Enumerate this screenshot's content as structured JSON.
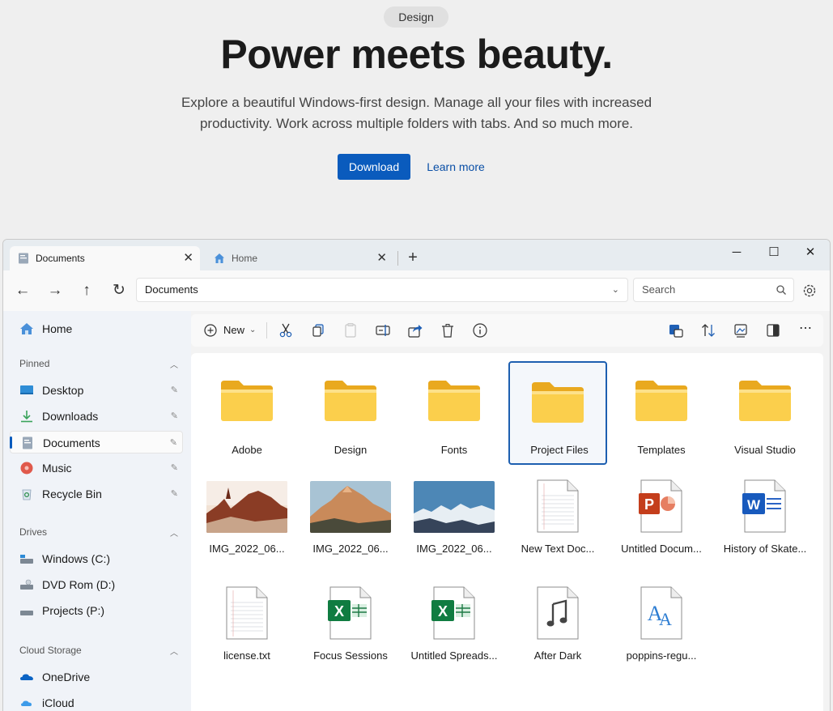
{
  "hero": {
    "pill": "Design",
    "title": "Power meets beauty.",
    "description": "Explore a beautiful Windows-first design. Manage all your files with increased productivity. Work across multiple folders with tabs. And so much more.",
    "download_label": "Download",
    "learn_more_label": "Learn more",
    "accent_color": "#0a5bbd"
  },
  "window": {
    "tabs": [
      {
        "label": "Documents",
        "icon": "documents-icon",
        "active": true
      },
      {
        "label": "Home",
        "icon": "home-icon",
        "active": false
      }
    ],
    "new_tab_icon": "plus-icon",
    "controls": [
      "minimize-icon",
      "maximize-icon",
      "close-icon"
    ]
  },
  "navbar": {
    "address": "Documents",
    "search_placeholder": "Search"
  },
  "toolbar": {
    "new_label": "New",
    "icons": [
      "cut-icon",
      "copy-icon",
      "paste-icon",
      "rename-icon",
      "share-icon",
      "delete-icon",
      "info-icon",
      "preview-icon",
      "sort-icon",
      "image-icon",
      "pane-icon",
      "more-icon"
    ]
  },
  "sidebar": {
    "home": "Home",
    "pinned_header": "Pinned",
    "pinned": [
      {
        "label": "Desktop",
        "icon": "desktop-icon"
      },
      {
        "label": "Downloads",
        "icon": "downloads-icon"
      },
      {
        "label": "Documents",
        "icon": "documents-icon",
        "selected": true
      },
      {
        "label": "Music",
        "icon": "music-icon"
      },
      {
        "label": "Recycle Bin",
        "icon": "recycle-bin-icon"
      }
    ],
    "drives_header": "Drives",
    "drives": [
      {
        "label": "Windows (C:)",
        "icon": "drive-icon"
      },
      {
        "label": "DVD Rom (D:)",
        "icon": "dvd-icon"
      },
      {
        "label": "Projects (P:)",
        "icon": "drive-icon"
      }
    ],
    "cloud_header": "Cloud Storage",
    "cloud": [
      {
        "label": "OneDrive",
        "icon": "onedrive-icon"
      },
      {
        "label": "iCloud",
        "icon": "icloud-icon"
      }
    ]
  },
  "files": [
    {
      "name": "Adobe",
      "type": "folder"
    },
    {
      "name": "Design",
      "type": "folder"
    },
    {
      "name": "Fonts",
      "type": "folder"
    },
    {
      "name": "Project Files",
      "type": "folder",
      "selected": true
    },
    {
      "name": "Templates",
      "type": "folder"
    },
    {
      "name": "Visual Studio",
      "type": "folder"
    },
    {
      "name": "IMG_2022_06...",
      "type": "photo-desert"
    },
    {
      "name": "IMG_2022_06...",
      "type": "photo-mountain"
    },
    {
      "name": "IMG_2022_06...",
      "type": "photo-snow"
    },
    {
      "name": "New Text Doc...",
      "type": "text"
    },
    {
      "name": "Untitled Docum...",
      "type": "powerpoint"
    },
    {
      "name": "History of Skate...",
      "type": "word"
    },
    {
      "name": "license.txt",
      "type": "text"
    },
    {
      "name": "Focus Sessions",
      "type": "excel"
    },
    {
      "name": "Untitled Spreads...",
      "type": "excel"
    },
    {
      "name": "After Dark",
      "type": "audio"
    },
    {
      "name": "poppins-regu...",
      "type": "font"
    }
  ]
}
